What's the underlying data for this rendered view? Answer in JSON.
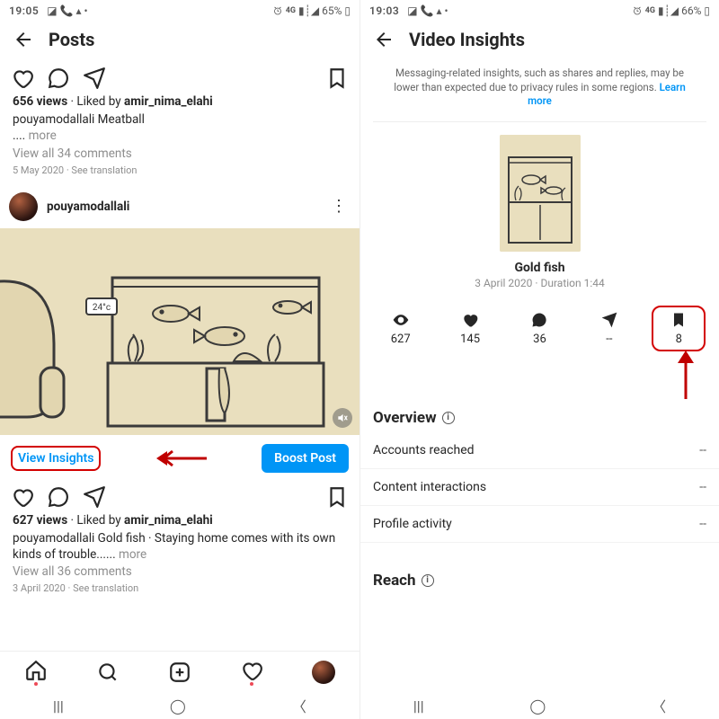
{
  "left": {
    "status": {
      "time": "19:05",
      "battery": "65%",
      "net": "4G"
    },
    "header": {
      "title": "Posts"
    },
    "post1": {
      "views_label": "656 views",
      "liked_prefix": " · Liked by ",
      "liked_by": "amir_nima_elahi",
      "caption_user": "pouyamodallali",
      "caption_text": " Meatball",
      "more_ellipsis": ".... ",
      "more_label": "more",
      "comments": "View all 34 comments",
      "date": "5 May 2020",
      "see_translation": " · See translation"
    },
    "post2": {
      "username": "pouyamodallali",
      "aquarium_temp": "24°c",
      "view_insights": "View Insights",
      "boost": "Boost Post",
      "views_label": "627 views",
      "liked_prefix": " · Liked by ",
      "liked_by": "amir_nima_elahi",
      "caption_user": "pouyamodallali",
      "caption_text": " Gold fish · Staying home comes with its own kinds of trouble...... ",
      "more_label": "more",
      "comments": "View all 36 comments",
      "date": "3 April 2020",
      "see_translation": " · See translation"
    }
  },
  "right": {
    "status": {
      "time": "19:03",
      "battery": "66%",
      "net": "4G"
    },
    "header": {
      "title": "Video Insights"
    },
    "notice": "Messaging-related insights, such as shares and replies, may be lower than expected due to privacy rules in some regions. ",
    "learn_more": "Learn more",
    "video": {
      "title": "Gold fish",
      "subtitle": "3 April 2020 · Duration 1:44"
    },
    "stats": {
      "views": "627",
      "likes": "145",
      "comments": "36",
      "shares": "--",
      "saves": "8"
    },
    "overview": {
      "title": "Overview",
      "rows": [
        {
          "k": "Accounts reached",
          "v": "--"
        },
        {
          "k": "Content interactions",
          "v": "--"
        },
        {
          "k": "Profile activity",
          "v": "--"
        }
      ]
    },
    "reach": {
      "title": "Reach"
    }
  }
}
